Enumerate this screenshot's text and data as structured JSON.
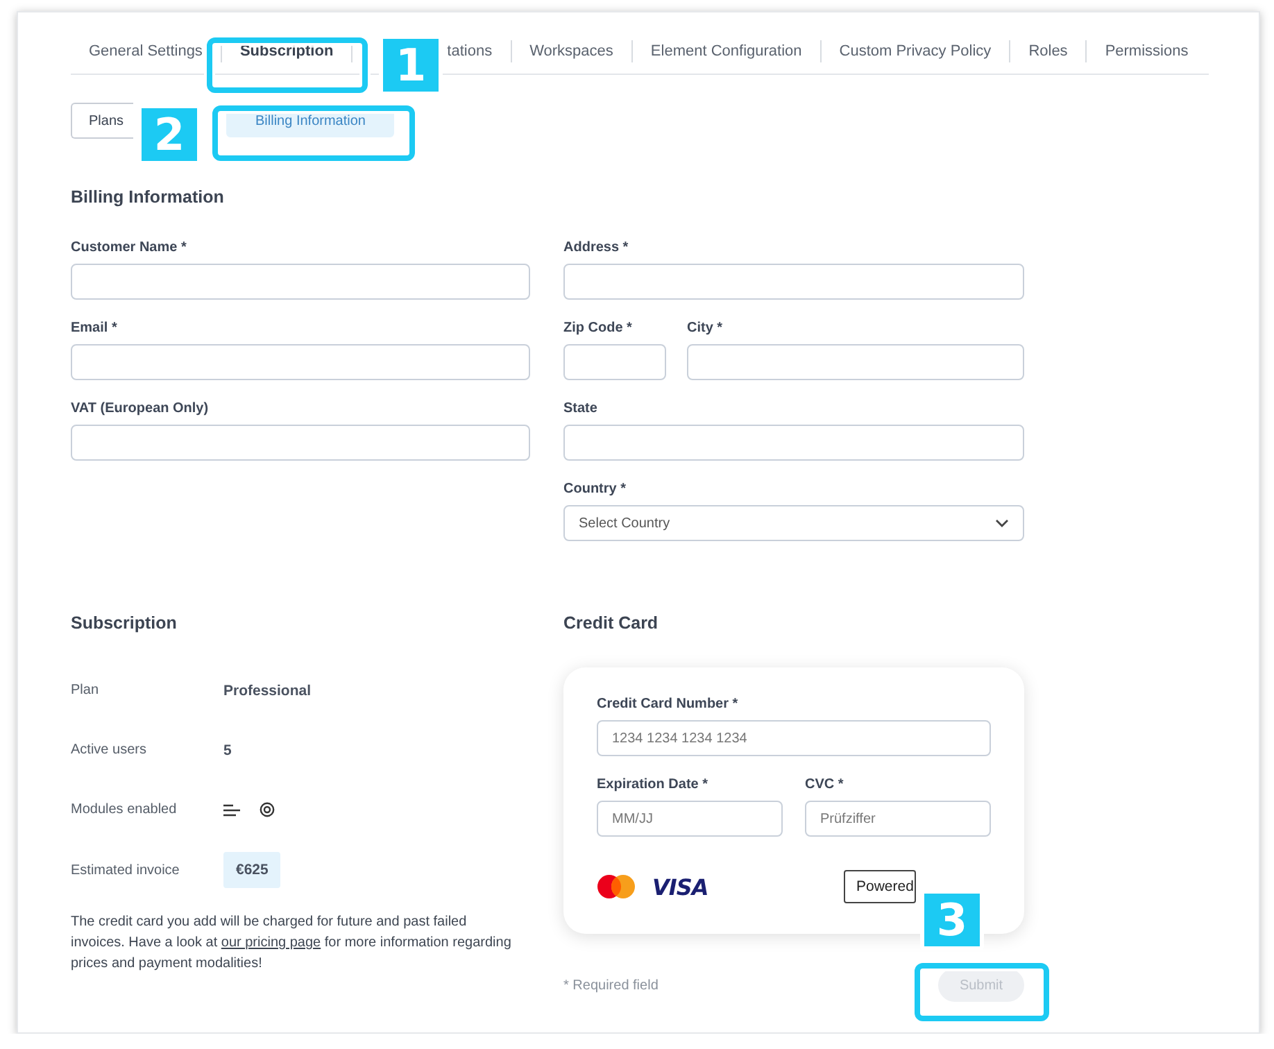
{
  "tabs": [
    {
      "label": "General Settings",
      "selected": false
    },
    {
      "label": "Subscription",
      "selected": true
    },
    {
      "label": "tations",
      "selected": false
    },
    {
      "label": "Workspaces",
      "selected": false
    },
    {
      "label": "Element Configuration",
      "selected": false
    },
    {
      "label": "Custom Privacy Policy",
      "selected": false
    },
    {
      "label": "Roles",
      "selected": false
    },
    {
      "label": "Permissions",
      "selected": false
    }
  ],
  "subtabs": [
    {
      "label": "Plans",
      "selected": false
    },
    {
      "label": "Billing Information",
      "selected": true
    }
  ],
  "billing": {
    "title": "Billing Information",
    "left": [
      {
        "label": "Customer Name *",
        "kind": "text"
      },
      {
        "label": "Email *",
        "kind": "text"
      },
      {
        "label": "VAT (European Only)",
        "kind": "text"
      }
    ],
    "right": [
      [
        {
          "label": "Address *",
          "kind": "text"
        }
      ],
      [
        {
          "label": "Zip Code *",
          "kind": "text"
        },
        {
          "label": "City *",
          "kind": "text"
        }
      ],
      [
        {
          "label": "State",
          "kind": "text"
        }
      ],
      [
        {
          "label": "Country *",
          "kind": "select",
          "placeholder": "Select Country"
        }
      ]
    ]
  },
  "subscription": {
    "title": "Subscription",
    "rows": [
      {
        "label": "Plan",
        "kind": "text",
        "value": "Professional"
      },
      {
        "label": "Active users",
        "kind": "text",
        "value": "5"
      },
      {
        "label": "Modules enabled",
        "kind": "icons"
      },
      {
        "label": "Estimated invoice",
        "kind": "badge",
        "value": "€625"
      }
    ],
    "note": {
      "before": "The credit card you add will be charged for future and past failed invoices. Have a look at ",
      "link": "our pricing page",
      "after": " for more information regarding prices and payment modalities!"
    }
  },
  "credit_card": {
    "title": "Credit Card",
    "fields": [
      {
        "label": "Credit Card Number *",
        "placeholder": "1234 1234 1234 1234"
      },
      {
        "label": "Expiration Date *",
        "placeholder": "MM/JJ"
      },
      {
        "label": "CVC *",
        "placeholder": "Prüfziffer"
      }
    ],
    "brand": "VISA",
    "powered": "Powered"
  },
  "footer": {
    "required_note": "* Required field",
    "submit": {
      "label": "Submit",
      "disabled": true
    }
  },
  "callouts": [
    {
      "number": "1"
    },
    {
      "number": "2"
    },
    {
      "number": "3"
    }
  ]
}
